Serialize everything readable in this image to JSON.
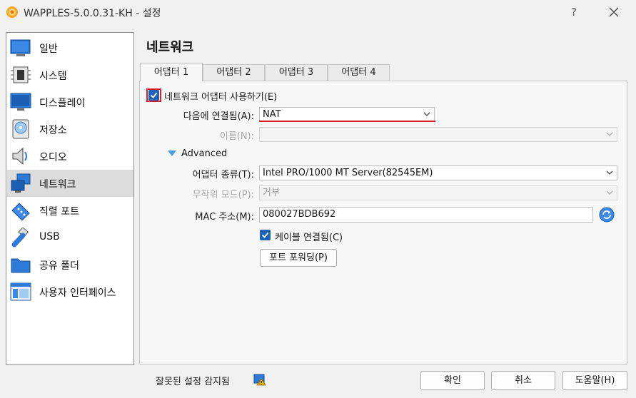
{
  "window": {
    "title": "WAPPLES-5.0.0.31-KH - 설정",
    "help_label": "?"
  },
  "sidebar": {
    "items": [
      {
        "label": "일반",
        "icon": "general-icon"
      },
      {
        "label": "시스템",
        "icon": "system-chip-icon"
      },
      {
        "label": "디스플레이",
        "icon": "display-monitor-icon"
      },
      {
        "label": "저장소",
        "icon": "storage-disk-icon"
      },
      {
        "label": "오디오",
        "icon": "audio-speaker-icon"
      },
      {
        "label": "네트워크",
        "icon": "network-icon",
        "selected": true
      },
      {
        "label": "직렬 포트",
        "icon": "serial-port-icon"
      },
      {
        "label": "USB",
        "icon": "usb-icon"
      },
      {
        "label": "공유 폴더",
        "icon": "shared-folder-icon"
      },
      {
        "label": "사용자 인터페이스",
        "icon": "user-interface-icon"
      }
    ]
  },
  "main": {
    "title": "네트워크",
    "tabs": [
      {
        "label": "어댑터 1",
        "active": true
      },
      {
        "label": "어댑터 2"
      },
      {
        "label": "어댑터 3"
      },
      {
        "label": "어댑터 4"
      }
    ],
    "enable_adapter": {
      "label": "네트워크 어댑터 사용하기(E)",
      "checked": true
    },
    "attached_to": {
      "label": "다음에 연결됨(A):",
      "value": "NAT"
    },
    "name": {
      "label": "이름(N):",
      "value": ""
    },
    "advanced": {
      "label": "Advanced"
    },
    "adapter_type": {
      "label": "어댑터 종류(T):",
      "value": "Intel PRO/1000 MT Server(82545EM)"
    },
    "promiscuous": {
      "label": "무작위 모드(P):",
      "value": "거부"
    },
    "mac": {
      "label": "MAC 주소(M):",
      "value": "080027BDB692"
    },
    "cable_connected": {
      "label": "케이블 연결됨(C)",
      "checked": true
    },
    "port_forwarding": {
      "label": "포트 포워딩(P)"
    }
  },
  "footer": {
    "warning": "잘못된 설정 감지됨",
    "ok": "확인",
    "cancel": "취소",
    "help": "도움말(H)"
  },
  "colors": {
    "accent": "#1e63b8",
    "highlight_red": "#d9202e",
    "selected_bg": "#dcdcdc"
  }
}
